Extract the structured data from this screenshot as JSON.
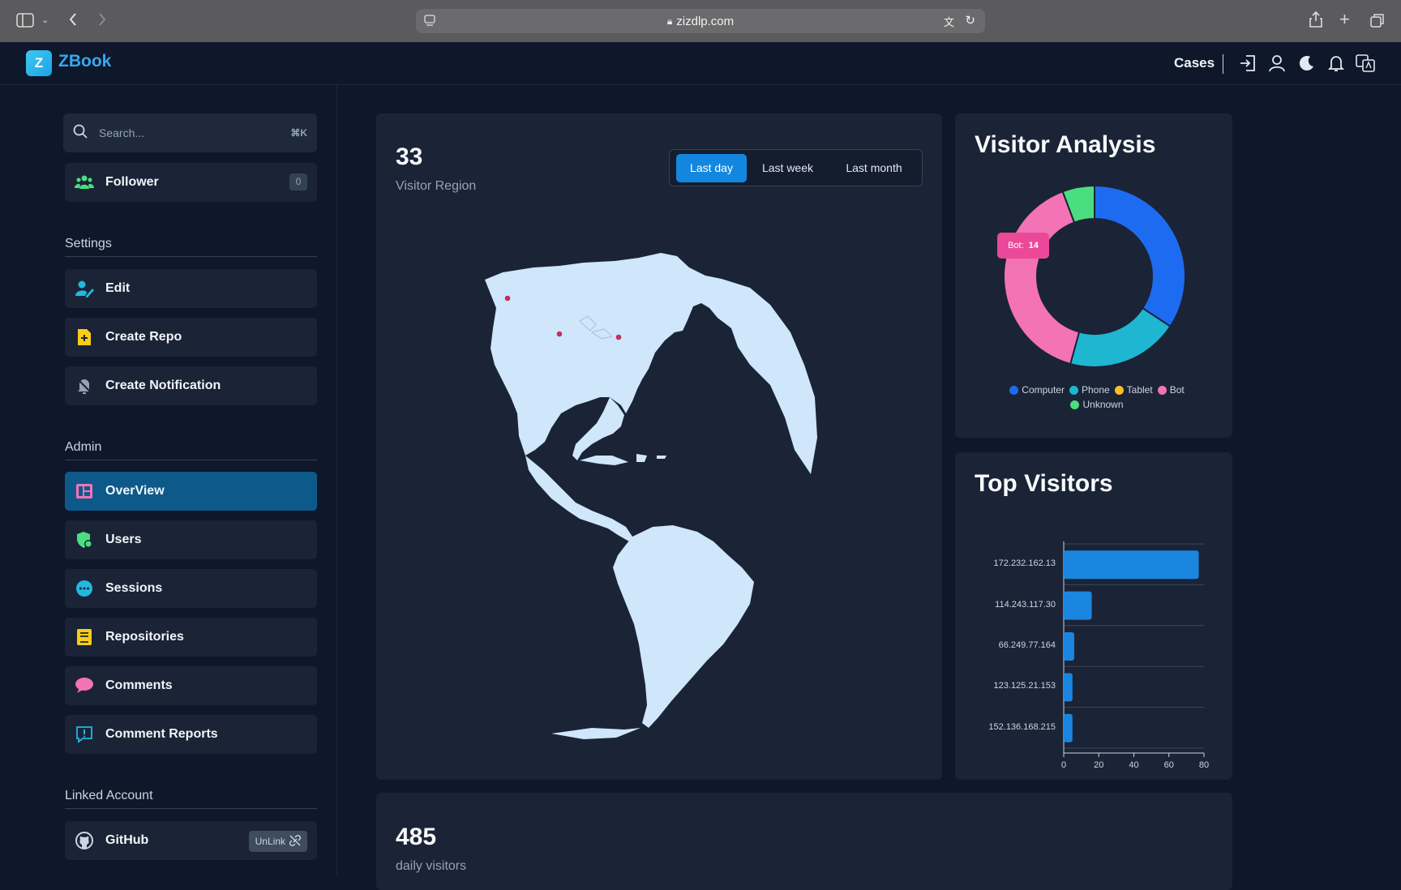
{
  "browser": {
    "url": "zizdlp.com"
  },
  "app": {
    "name": "ZBook",
    "logo_letter": "Z",
    "cases_label": "Cases"
  },
  "sidebar": {
    "search_placeholder": "Search...",
    "search_shortcut": "⌘K",
    "follower": {
      "label": "Follower",
      "count": "0"
    },
    "settings_title": "Settings",
    "settings_items": [
      {
        "label": "Edit"
      },
      {
        "label": "Create Repo"
      },
      {
        "label": "Create Notification"
      }
    ],
    "admin_title": "Admin",
    "admin_items": [
      {
        "label": "OverView"
      },
      {
        "label": "Users"
      },
      {
        "label": "Sessions"
      },
      {
        "label": "Repositories"
      },
      {
        "label": "Comments"
      },
      {
        "label": "Comment Reports"
      }
    ],
    "linked_title": "Linked Account",
    "linked_items": [
      {
        "label": "GitHub",
        "action": "UnLink"
      }
    ]
  },
  "region_card": {
    "count": "33",
    "label": "Visitor Region",
    "ranges": [
      "Last day",
      "Last week",
      "Last month"
    ],
    "selected_range": "Last day"
  },
  "visitor_analysis": {
    "title": "Visitor Analysis",
    "tooltip": {
      "label": "Bot:",
      "value": "14"
    }
  },
  "top_visitors": {
    "title": "Top Visitors"
  },
  "daily_card": {
    "count": "485",
    "label": "daily visitors"
  },
  "chart_data": [
    {
      "type": "pie",
      "title": "Visitor Analysis",
      "categories": [
        "Computer",
        "Phone",
        "Tablet",
        "Bot",
        "Unknown"
      ],
      "values": [
        12,
        7,
        0,
        14,
        2
      ],
      "colors": [
        "#1d6bf0",
        "#1fb6d2",
        "#fbbf24",
        "#f472b6",
        "#4ade80"
      ],
      "legend_position": "bottom"
    },
    {
      "type": "bar",
      "orientation": "horizontal",
      "title": "Top Visitors",
      "categories": [
        "172.232.162.13",
        "114.243.117.30",
        "66.249.77.164",
        "123.125.21.153",
        "152.136.168.215"
      ],
      "values": [
        77,
        16,
        6,
        5,
        5
      ],
      "xlim": [
        0,
        80
      ],
      "xticks": [
        0,
        20,
        40,
        60,
        80
      ],
      "color": "#1a86e0",
      "grid": true
    }
  ]
}
